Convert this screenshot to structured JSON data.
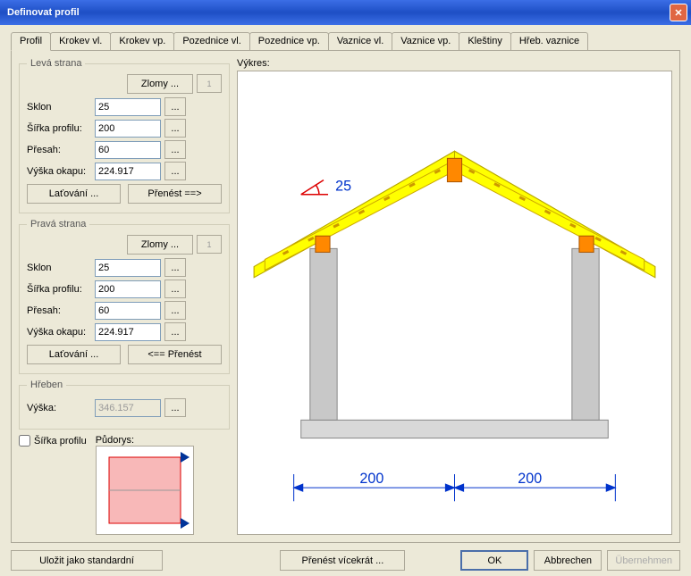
{
  "title": "Definovat profil",
  "tabs": [
    "Profil",
    "Krokev vl.",
    "Krokev vp.",
    "Pozednice vl.",
    "Pozednice vp.",
    "Vaznice vl.",
    "Vaznice vp.",
    "Kleštiny",
    "Hřeb. vaznice"
  ],
  "drawing_label": "Výkres:",
  "leva": {
    "legend": "Levá strana",
    "zlomy": "Zlomy ...",
    "spin": "1",
    "sklon_l": "Sklon",
    "sklon_v": "25",
    "sirka_l": "Šířka profilu:",
    "sirka_v": "200",
    "presah_l": "Přesah:",
    "presah_v": "60",
    "vyska_l": "Výška okapu:",
    "vyska_v": "224.917",
    "latovani": "Laťování ...",
    "prenest": "Přenést ==>"
  },
  "prava": {
    "legend": "Pravá strana",
    "zlomy": "Zlomy ...",
    "spin": "1",
    "sklon_l": "Sklon",
    "sklon_v": "25",
    "sirka_l": "Šířka profilu:",
    "sirka_v": "200",
    "presah_l": "Přesah:",
    "presah_v": "60",
    "vyska_l": "Výška okapu:",
    "vyska_v": "224.917",
    "latovani": "Laťování ...",
    "prenest": "<== Přenést"
  },
  "hreben": {
    "legend": "Hřeben",
    "vyska_l": "Výška:",
    "vyska_v": "346.157"
  },
  "sirka_check": "Šířka profilu",
  "pudorys_label": "Půdorys:",
  "drawing": {
    "angle": "25",
    "dim_left": "200",
    "dim_right": "200"
  },
  "buttons": {
    "save_std": "Uložit jako standardní",
    "multi": "Přenést vícekrát ...",
    "ok": "OK",
    "cancel": "Abbrechen",
    "apply": "Übernehmen"
  },
  "dots": "..."
}
